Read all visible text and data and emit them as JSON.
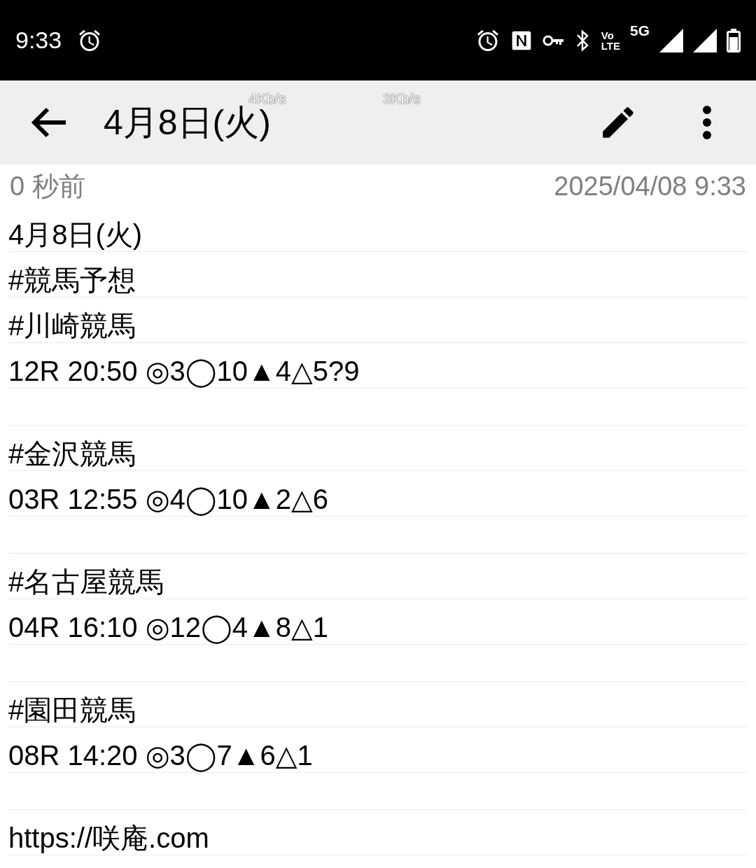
{
  "status_bar": {
    "time": "9:33",
    "network_label": "5G",
    "volte_label_top": "Vo",
    "volte_label_bottom": "LTE"
  },
  "toolbar": {
    "title": "4月8日(火)"
  },
  "network_speeds": [
    "4Kb/s",
    "3Kb/s"
  ],
  "meta": {
    "relative_time": "0 秒前",
    "timestamp": "2025/04/08 9:33"
  },
  "note": {
    "blocks": [
      {
        "lines": [
          "4月8日(火)",
          "#競馬予想",
          "#川崎競馬",
          "12R 20:50 ◎3◯10▲4△5?9"
        ]
      },
      {
        "lines": [
          "#金沢競馬",
          "03R 12:55 ◎4◯10▲2△6"
        ]
      },
      {
        "lines": [
          "#名古屋競馬",
          "04R 16:10 ◎12◯4▲8△1"
        ]
      },
      {
        "lines": [
          "#園田競馬",
          "08R 14:20 ◎3◯7▲6△1"
        ]
      },
      {
        "lines": [
          "https://咲庵.com"
        ]
      }
    ]
  }
}
